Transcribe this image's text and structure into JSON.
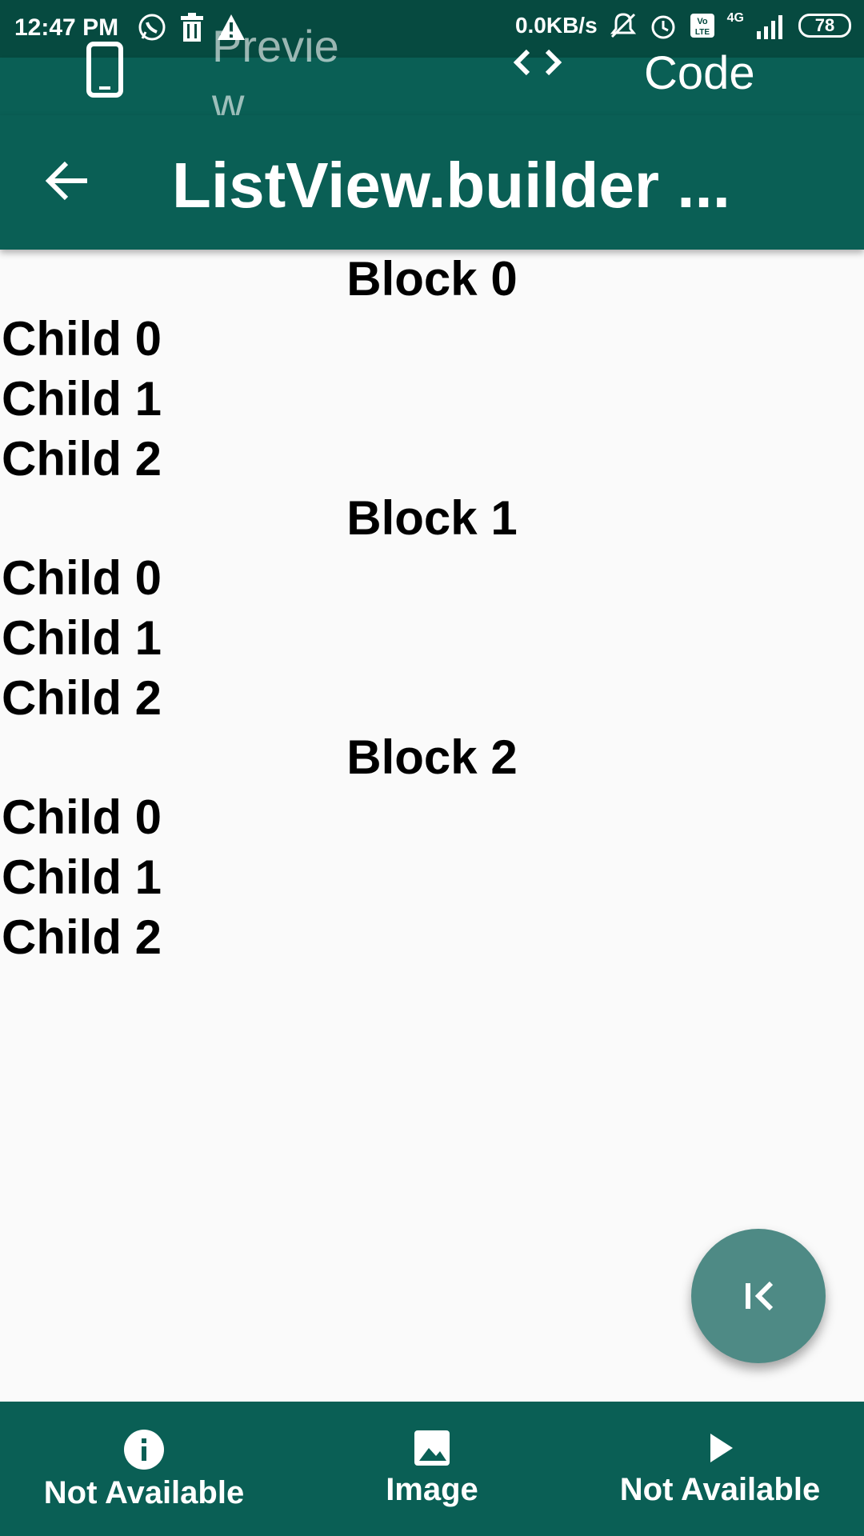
{
  "status_bar": {
    "time": "12:47 PM",
    "net_speed": "0.0KB/s",
    "network": "4G",
    "battery": "78"
  },
  "tabs": [
    {
      "label": "Preview",
      "icon": "phone-icon"
    },
    {
      "label": "Code",
      "icon": "code-icon"
    }
  ],
  "appbar": {
    "title": "ListView.builder ..."
  },
  "blocks": [
    {
      "title": "Block 0",
      "children": [
        "Child 0",
        "Child 1",
        "Child 2"
      ]
    },
    {
      "title": "Block 1",
      "children": [
        "Child 0",
        "Child 1",
        "Child 2"
      ]
    },
    {
      "title": "Block 2",
      "children": [
        "Child 0",
        "Child 1",
        "Child 2"
      ]
    }
  ],
  "bottom_nav": [
    {
      "label": "Not Available",
      "icon": "info-icon"
    },
    {
      "label": "Image",
      "icon": "image-icon"
    },
    {
      "label": "Not Available",
      "icon": "play-icon"
    }
  ],
  "colors": {
    "primary": "#0a5f55",
    "status_bar": "#064a40",
    "fab": "#4e8a85",
    "background": "#fafafa"
  }
}
